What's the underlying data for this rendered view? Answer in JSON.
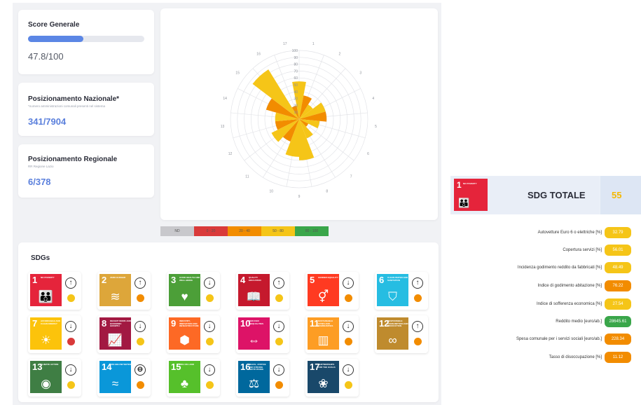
{
  "score_card": {
    "title": "Score Generale",
    "value": "47.8/100",
    "progress": 0.478
  },
  "national_card": {
    "title": "Posizionamento Nazionale*",
    "subtitle": "*numero amministrazioni comunali presenti nel sistema",
    "value": "341/7904"
  },
  "regional_card": {
    "title": "Posizionamento Regionale",
    "subtitle": "RR Regione Lazio",
    "value": "6/378"
  },
  "chart_data": {
    "type": "polar-bar",
    "radial_ticks": [
      "10",
      "20",
      "30",
      "40",
      "50",
      "60",
      "70",
      "80",
      "90",
      "100"
    ],
    "categories": [
      "1",
      "2",
      "3",
      "4",
      "5",
      "6",
      "7",
      "8",
      "9",
      "10",
      "11",
      "12",
      "13",
      "14",
      "15",
      "16",
      "17"
    ],
    "values": [
      55,
      35,
      25,
      40,
      40,
      30,
      15,
      30,
      60,
      55,
      35,
      45,
      35,
      35,
      50,
      85,
      20
    ],
    "colors": [
      "#f5c518",
      "#f28c00",
      "#f5c518",
      "#f5c518",
      "#f28c00",
      "#f5c518",
      "#f28c00",
      "#f5c518",
      "#f5c518",
      "#f5c518",
      "#f28c00",
      "#f5c518",
      "#f28c00",
      "#f5c518",
      "#f28c00",
      "#f5c518",
      "#f28c00"
    ],
    "legend": [
      {
        "label": "ND",
        "color": "#c8c8cc"
      },
      {
        "label": "0 - 20",
        "color": "#d93a3a"
      },
      {
        "label": "20 - 40",
        "color": "#f28c00"
      },
      {
        "label": "50 - 80",
        "color": "#f5c518"
      },
      {
        "label": "80 - 100",
        "color": "#3aa64a"
      }
    ]
  },
  "sdgs": {
    "title": "SDGs",
    "items": [
      {
        "num": "1",
        "label": "No poverty",
        "color": "#e5243b",
        "glyph": "👪",
        "trend": "↑",
        "dot": "#f5c518"
      },
      {
        "num": "2",
        "label": "Zero hunger",
        "color": "#dda63a",
        "glyph": "≋",
        "trend": "↑",
        "dot": "#f28c00"
      },
      {
        "num": "3",
        "label": "Good health and well-being",
        "color": "#4c9f38",
        "glyph": "♥",
        "trend": "↓",
        "dot": "#f5c518"
      },
      {
        "num": "4",
        "label": "Quality education",
        "color": "#c5192d",
        "glyph": "📖",
        "trend": "↑",
        "dot": "#f5c518"
      },
      {
        "num": "5",
        "label": "Gender equality",
        "color": "#ff3a21",
        "glyph": "⚥",
        "trend": "↓",
        "dot": "#f28c00"
      },
      {
        "num": "6",
        "label": "Clean water and sanitation",
        "color": "#26bde2",
        "glyph": "⛉",
        "trend": "↑",
        "dot": "#f28c00"
      },
      {
        "num": "7",
        "label": "Affordable and clean energy",
        "color": "#fcc30b",
        "glyph": "☀",
        "trend": "↓",
        "dot": "#d93a3a"
      },
      {
        "num": "8",
        "label": "Decent work and economic growth",
        "color": "#a21942",
        "glyph": "📈",
        "trend": "↓",
        "dot": "#f5c518"
      },
      {
        "num": "9",
        "label": "Industry, innovation and infrastructure",
        "color": "#fd6925",
        "glyph": "⬢",
        "trend": "↓",
        "dot": "#f5c518"
      },
      {
        "num": "10",
        "label": "Reduced inequalities",
        "color": "#dd1367",
        "glyph": "⇔",
        "trend": "↓",
        "dot": "#f5c518"
      },
      {
        "num": "11",
        "label": "Sustainable cities and communities",
        "color": "#fd9d24",
        "glyph": "▥",
        "trend": "↓",
        "dot": "#f28c00"
      },
      {
        "num": "12",
        "label": "Responsible consumption and production",
        "color": "#bf8b2e",
        "glyph": "∞",
        "trend": "↑",
        "dot": "#f28c00"
      },
      {
        "num": "13",
        "label": "Climate action",
        "color": "#3f7e44",
        "glyph": "◉",
        "trend": "↓",
        "dot": "#f5c518"
      },
      {
        "num": "14",
        "label": "Life below water",
        "color": "#0a97d9",
        "glyph": "≈",
        "trend": "⊖",
        "dot": "#f28c00"
      },
      {
        "num": "15",
        "label": "Life on land",
        "color": "#56c02b",
        "glyph": "♣",
        "trend": "↓",
        "dot": "#f5c518"
      },
      {
        "num": "16",
        "label": "Peace, justice and strong institutions",
        "color": "#00689d",
        "glyph": "⚖",
        "trend": "↓",
        "dot": "#f28c00"
      },
      {
        "num": "17",
        "label": "Partnerships for the goals",
        "color": "#19486a",
        "glyph": "❀",
        "trend": "↓",
        "dot": "#f5c518"
      }
    ]
  },
  "sdg_detail": {
    "badge_num": "1",
    "badge_label": "No poverty",
    "badge_color": "#e5243b",
    "title": "SDG TOTALE",
    "score": "55",
    "indicators": [
      {
        "label": "Autovetture Euro 6 o elettriche [%]",
        "value": "32.79",
        "color": "#f5c518"
      },
      {
        "label": "Copertura servizi [%]",
        "value": "56.01",
        "color": "#f5c518"
      },
      {
        "label": "Incidenza godimento reddito da fabbricati [%]",
        "value": "48.49",
        "color": "#f5c518"
      },
      {
        "label": "Indice di godimento abitazione [%]",
        "value": "76.22",
        "color": "#f28c00"
      },
      {
        "label": "Indice di sofferenza economica [%]",
        "value": "27.54",
        "color": "#f5c518"
      },
      {
        "label": "Reddito medio [euro/ab.]",
        "value": "28645.61",
        "color": "#3aa64a"
      },
      {
        "label": "Spesa comunale per i servizi sociali [euro/ab.]",
        "value": "228.34",
        "color": "#f28c00"
      },
      {
        "label": "Tasso di disoccupazione [%]",
        "value": "11.12",
        "color": "#f28c00"
      }
    ]
  }
}
